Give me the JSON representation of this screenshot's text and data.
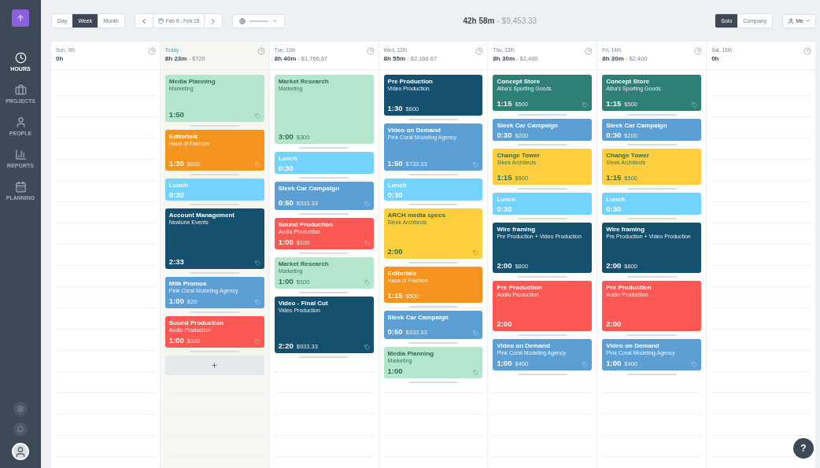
{
  "sidebar": {
    "items": [
      {
        "kind": "hours",
        "label": "HOURS",
        "selected": true
      },
      {
        "kind": "projects",
        "label": "PROJECTS",
        "selected": false
      },
      {
        "kind": "people",
        "label": "PEOPLE",
        "selected": false
      },
      {
        "kind": "reports",
        "label": "REPORTS",
        "selected": false
      },
      {
        "kind": "planning",
        "label": "PLANNING",
        "selected": false
      }
    ]
  },
  "toolbar": {
    "views": [
      {
        "label": "Day",
        "selected": false
      },
      {
        "label": "Week",
        "selected": true
      },
      {
        "label": "Month",
        "selected": false
      }
    ],
    "date_range": "Feb 9 - Feb 15",
    "total_hours": "42h 58m",
    "total_amount": "- $9,453.33",
    "scopes": [
      {
        "label": "Solo",
        "selected": true
      },
      {
        "label": "Company",
        "selected": false
      }
    ],
    "user_menu": "Me"
  },
  "days": [
    {
      "label": "Sun, 9th",
      "hours": "0h",
      "today": false
    },
    {
      "label": "Today",
      "hours": "8h 23m",
      "amount": "- $720",
      "today": true,
      "add_slot": true,
      "events": [
        {
          "title": "Media Planning",
          "subtitle": "Marketing",
          "duration": "1:50",
          "color": "#b3e6cc",
          "tagged": true
        },
        {
          "title": "Editorials",
          "subtitle": "Haus of Fashion",
          "duration": "1:30",
          "amount": "$600",
          "color": "#f5941e",
          "tagged": true
        },
        {
          "title": "Lunch",
          "duration": "0:30",
          "color": "#74d3fc",
          "tagged": false
        },
        {
          "title": "Account Management",
          "subtitle": "Neatune Events",
          "duration": "2:33",
          "color": "#16506f",
          "tagged": true
        },
        {
          "title": "Milk Promos",
          "subtitle": "Pink Coral Modeling Agency",
          "duration": "1:00",
          "amount": "$20",
          "color": "#5b9fd4",
          "tagged": true
        },
        {
          "title": "Sound Production",
          "subtitle": "Audio Production",
          "duration": "1:00",
          "amount": "$100",
          "color": "#fb5753",
          "tagged": true
        }
      ]
    },
    {
      "label": "Tue, 11th",
      "hours": "8h 40m",
      "amount": "- $1,766.67",
      "today": false,
      "events": [
        {
          "title": "Market Research",
          "subtitle": "Marketing",
          "duration": "3:00",
          "amount": "$300",
          "color": "#b3e6cc",
          "tagged": false
        },
        {
          "title": "Lunch",
          "duration": "0:30",
          "color": "#74d3fc",
          "tagged": false
        },
        {
          "title": "Sleek Car Campaign",
          "duration": "0:50",
          "amount": "$333.33",
          "color": "#5b9fd4",
          "tagged": true
        },
        {
          "title": "Sound Production",
          "subtitle": "Audio Production",
          "duration": "1:00",
          "amount": "$100",
          "color": "#fb5753",
          "tagged": true
        },
        {
          "title": "Market Research",
          "subtitle": "Marketing",
          "duration": "1:00",
          "amount": "$100",
          "color": "#b3e6cc",
          "tagged": true
        },
        {
          "title": "Video - Final Cut",
          "subtitle": "Video Production",
          "duration": "2:20",
          "amount": "$933.33",
          "color": "#16506f",
          "tagged": true
        }
      ]
    },
    {
      "label": "Wed, 12th",
      "hours": "8h 55m",
      "amount": "- $2,166.67",
      "today": false,
      "events": [
        {
          "title": "Pre Production",
          "subtitle": "Video Production",
          "duration": "1:30",
          "amount": "$600",
          "color": "#16506f",
          "tagged": false
        },
        {
          "title": "Video on Demand",
          "subtitle": "Pink Coral Modeling Agency",
          "duration": "1:50",
          "amount": "$733.33",
          "color": "#5b9fd4",
          "tagged": true
        },
        {
          "title": "Lunch",
          "duration": "0:30",
          "color": "#74d3fc",
          "tagged": false
        },
        {
          "title": "ARCH media specs",
          "subtitle": "Sleek Architects",
          "duration": "2:00",
          "color": "#fdcf3f",
          "tagged": true
        },
        {
          "title": "Editorials",
          "subtitle": "Haus of Fashion",
          "duration": "1:15",
          "amount": "$500",
          "color": "#f5941e",
          "tagged": false
        },
        {
          "title": "Sleek Car Campaign",
          "duration": "0:50",
          "amount": "$333.33",
          "color": "#5b9fd4",
          "tagged": true
        },
        {
          "title": "Media Planning",
          "subtitle": "Marketing",
          "duration": "1:00",
          "color": "#b3e6cc",
          "tagged": true
        }
      ]
    },
    {
      "label": "Thu, 13th",
      "hours": "8h 30m",
      "amount": "- $2,400",
      "today": false,
      "events": [
        {
          "title": "Concept Store",
          "subtitle": "Alba's Sporting Goods",
          "duration": "1:15",
          "amount": "$500",
          "color": "#2e8077",
          "tagged": true
        },
        {
          "title": "Sleek Car Campaign",
          "duration": "0:30",
          "amount": "$200",
          "color": "#5b9fd4",
          "tagged": false
        },
        {
          "title": "Change Tower",
          "subtitle": "Sleek Architects",
          "duration": "1:15",
          "amount": "$500",
          "color": "#fdcf3f",
          "tagged": false
        },
        {
          "title": "Lunch",
          "duration": "0:30",
          "color": "#74d3fc",
          "tagged": false
        },
        {
          "title": "Wire framing",
          "subtitle": "Pre Production + Video Production",
          "duration": "2:00",
          "amount": "$800",
          "color": "#16506f",
          "tagged": false
        },
        {
          "title": "Pre Production",
          "subtitle": "Audio Production",
          "duration": "2:00",
          "color": "#fb5753",
          "tagged": false
        },
        {
          "title": "Video on Demand",
          "subtitle": "Pink Coral Modeling Agency",
          "duration": "1:00",
          "amount": "$400",
          "color": "#5b9fd4",
          "tagged": true
        }
      ]
    },
    {
      "label": "Fri, 14th",
      "hours": "8h 30m",
      "amount": "- $2,400",
      "today": false,
      "events": [
        {
          "title": "Concept Store",
          "subtitle": "Alba's Sporting Goods",
          "duration": "1:15",
          "amount": "$500",
          "color": "#2e8077",
          "tagged": true
        },
        {
          "title": "Sleek Car Campaign",
          "duration": "0:30",
          "amount": "$200",
          "color": "#5b9fd4",
          "tagged": false
        },
        {
          "title": "Change Tower",
          "subtitle": "Sleek Architects",
          "duration": "1:15",
          "amount": "$500",
          "color": "#fdcf3f",
          "tagged": false
        },
        {
          "title": "Lunch",
          "duration": "0:30",
          "color": "#74d3fc",
          "tagged": false
        },
        {
          "title": "Wire framing",
          "subtitle": "Pre Production + Video Production",
          "duration": "2:00",
          "amount": "$800",
          "color": "#16506f",
          "tagged": false
        },
        {
          "title": "Pre Production",
          "subtitle": "Audio Production",
          "duration": "2:00",
          "color": "#fb5753",
          "tagged": false
        },
        {
          "title": "Video on Demand",
          "subtitle": "Pink Coral Modeling Agency",
          "duration": "1:00",
          "amount": "$400",
          "color": "#5b9fd4",
          "tagged": true
        }
      ]
    },
    {
      "label": "Sat, 15th",
      "hours": "0h",
      "today": false
    }
  ],
  "help_button": "?"
}
